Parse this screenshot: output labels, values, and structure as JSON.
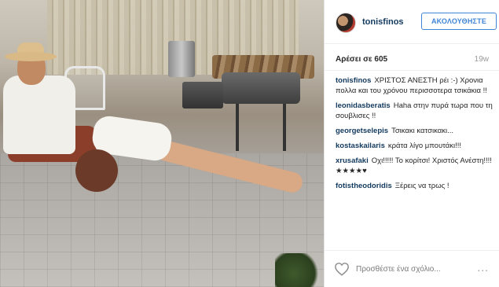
{
  "post": {
    "author": "tonisfinos",
    "follow_label": "ΑΚΟΛΟΥΘΗΣΤΕ",
    "likes": "Αρέσει σε 605",
    "time": "19w",
    "comments": [
      {
        "user": "tonisfinos",
        "text": "ΧΡΙΣΤΟΣ ΑΝΕΣΤΗ ρέι :-) Χρονια πολλα και του χρόνου περισσοτερα τσικάκια !!"
      },
      {
        "user": "leonidasberatis",
        "text": "Haha στην πυρά τωρα που τη σουβλισες !!"
      },
      {
        "user": "georgetselepis",
        "text": "Τσικακι κατσικακι..."
      },
      {
        "user": "kostaskailaris",
        "text": "κράτα λίγο μπουτάκι!!!"
      },
      {
        "user": "xrusafaki",
        "text": "Οχι!!!!! Το κορίτσι! Χριστός Ανέστη!!!!★★★★♥"
      },
      {
        "user": "fotistheodoridis",
        "text": "Ξέρεις να τρως !"
      }
    ],
    "comment_placeholder": "Προσθέστε ένα σχόλιο...",
    "more_label": "..."
  },
  "icons": {
    "heart": "heart-outline-icon"
  },
  "colors": {
    "link": "#12395e",
    "follow": "#3f85d6"
  }
}
